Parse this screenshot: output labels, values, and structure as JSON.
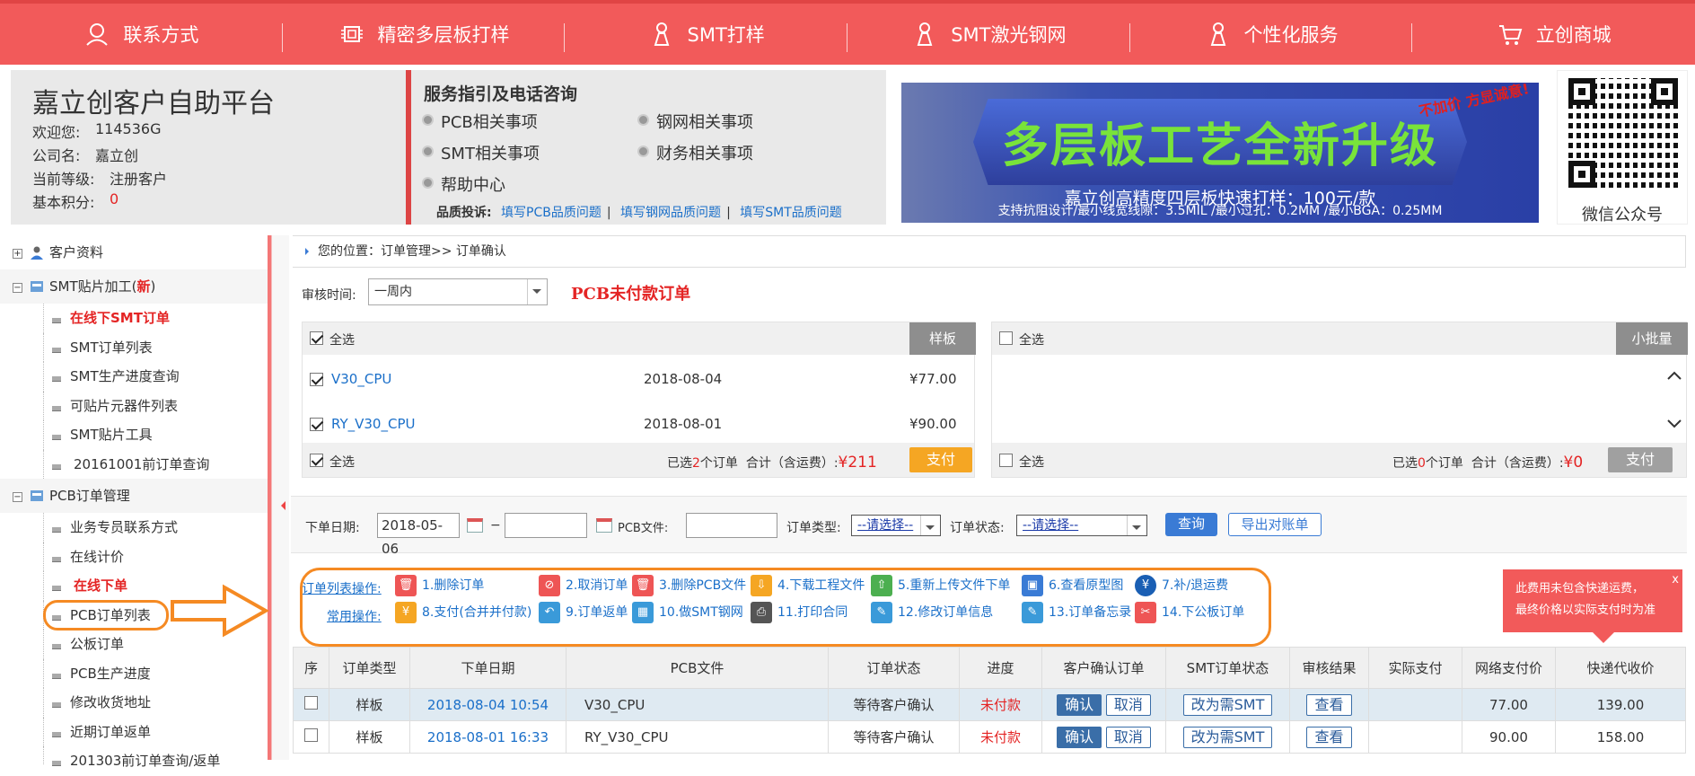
{
  "nav": [
    {
      "label": "联系方式",
      "icon": "contact-icon"
    },
    {
      "label": "精密多层板打样",
      "icon": "chip-icon"
    },
    {
      "label": "SMT打样",
      "icon": "smt-icon"
    },
    {
      "label": "SMT激光钢网",
      "icon": "stencil-icon"
    },
    {
      "label": "个性化服务",
      "icon": "service-icon"
    },
    {
      "label": "立创商城",
      "icon": "cart-icon"
    }
  ],
  "header": {
    "platform": "嘉立创客户自助平台",
    "welcome_label": "欢迎您:",
    "welcome_value": "114536G",
    "company_label": "公司名:",
    "company_value": "嘉立创",
    "level_label": "当前等级:",
    "level_value": "注册客户",
    "points_label": "基本积分:",
    "points_value": "0",
    "service_title": "服务指引及电话咨询",
    "services": [
      "PCB相关事项",
      "钢网相关事项",
      "SMT相关事项",
      "财务相关事项",
      "帮助中心"
    ],
    "complaint_label": "品质投诉:",
    "complaints": [
      "填写PCB品质问题",
      "填写钢网品质问题",
      "填写SMT品质问题"
    ],
    "banner_title": "多层板工艺全新升级",
    "banner_sub": "嘉立创高精度四层板快速打样：100元/款",
    "banner_foot": "支持抗阻设计/最小线宽线隙：3.5MIL /最小过孔：0.2MM /最小BGA：0.25MM",
    "banner_tag": "不加价 方显诚意!",
    "qr_label": "微信公众号"
  },
  "sidebar": {
    "groups": [
      {
        "label": "客户资料",
        "items": []
      },
      {
        "label": "SMT贴片加工(",
        "new": "新",
        "close": ")",
        "items": [
          "在线下SMT订单",
          "SMT订单列表",
          "SMT生产进度查询",
          "可贴片元器件列表",
          "SMT贴片工具",
          "20161001前订单查询"
        ]
      },
      {
        "label": "PCB订单管理",
        "items": [
          "业务专员联系方式",
          "在线计价",
          "在线下单",
          "PCB订单列表",
          "公板订单",
          "PCB生产进度",
          "修改收货地址",
          "近期订单返单",
          "201303前订单查询/返单"
        ]
      }
    ]
  },
  "breadcrumb": "您的位置：订单管理>> 订单确认",
  "filter": {
    "label": "审核时间:",
    "value": "一周内"
  },
  "unpaid_title": "PCB未付款订单",
  "left_panel": {
    "select_all": "全选",
    "tab": "样板",
    "rows": [
      {
        "name": "V30_CPU",
        "date": "2018-08-04",
        "price": "¥77.00"
      },
      {
        "name": "RY_V30_CPU",
        "date": "2018-08-01",
        "price": "¥90.00"
      }
    ],
    "selected_prefix": "已选",
    "selected_count": "2",
    "selected_suffix": "个订单",
    "total_label": "合计（含运费）:",
    "total": "¥211",
    "pay": "支付"
  },
  "right_panel": {
    "select_all": "全选",
    "tab": "小批量",
    "selected_prefix": "已选",
    "selected_count": "0",
    "selected_suffix": "个订单",
    "total_label": "合计（含运费）:",
    "total": "¥0",
    "pay": "支付"
  },
  "query": {
    "date_label": "下单日期:",
    "date_from": "2018-05-06",
    "date_sep": "−",
    "date_to": "",
    "file_label": "PCB文件:",
    "file_value": "",
    "type_label": "订单类型:",
    "type_value": "--请选择--",
    "status_label": "订单状态:",
    "status_value": "--请选择--",
    "search": "查询",
    "export": "导出对账单"
  },
  "ops": {
    "list_label": "订单列表操作:",
    "common_label": "常用操作:",
    "row1": [
      "1.删除订单",
      "2.取消订单",
      "3.删除PCB文件",
      "4.下载工程文件",
      "5.重新上传文件下单",
      "6.查看原型图",
      "7.补/退运费"
    ],
    "row2": [
      "8.支付(合并并付款)",
      "9.订单返单",
      "10.做SMT钢网",
      "11.打印合同",
      "12.修改订单信息",
      "13.订单备忘录",
      "14.下公板订单"
    ]
  },
  "note": {
    "line1": "此费用未包含快递运费，",
    "line2": "最终价格以实际支付时为准",
    "close": "x"
  },
  "table": {
    "headers": [
      "序",
      "订单类型",
      "下单日期",
      "PCB文件",
      "订单状态",
      "进度",
      "客户确认订单",
      "SMT订单状态",
      "审核结果",
      "实际支付",
      "网络支付价",
      "快递代收价"
    ],
    "rows": [
      {
        "type": "样板",
        "date": "2018-08-04 10:54",
        "file": "V30_CPU",
        "status": "等待客户确认",
        "progress": "未付款",
        "confirm": "确认",
        "cancel": "取消",
        "smt": "改为需SMT",
        "review": "查看",
        "paid": "",
        "net": "77.00",
        "courier": "139.00"
      },
      {
        "type": "样板",
        "date": "2018-08-01 16:33",
        "file": "RY_V30_CPU",
        "status": "等待客户确认",
        "progress": "未付款",
        "confirm": "确认",
        "cancel": "取消",
        "smt": "改为需SMT",
        "review": "查看",
        "paid": "",
        "net": "90.00",
        "courier": "158.00"
      }
    ]
  }
}
